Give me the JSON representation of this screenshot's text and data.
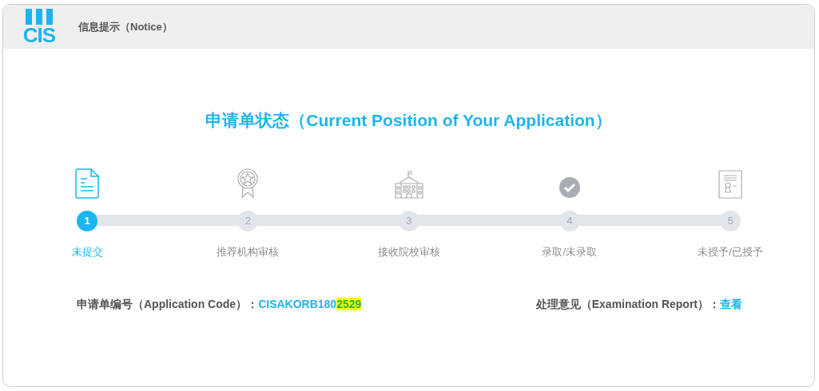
{
  "header": {
    "logo": "CIS",
    "title": "信息提示（Notice）"
  },
  "heading": "申请单状态（Current Position of Your Application）",
  "steps": [
    {
      "kind": "document",
      "number": "1",
      "label": "未提交",
      "selected": true
    },
    {
      "kind": "award",
      "number": "2",
      "label": "推荐机构审核",
      "selected": false
    },
    {
      "kind": "school",
      "number": "3",
      "label": "接收院校审核",
      "selected": false
    },
    {
      "kind": "check",
      "number": "4",
      "label": "录取/未录取",
      "selected": false
    },
    {
      "kind": "certificate",
      "number": "5",
      "label": "未授予/已授予",
      "selected": false
    }
  ],
  "application_code": {
    "label": "申请单编号（Application Code）：",
    "value": "CISAKORB180",
    "highlighted": "2529"
  },
  "examination_report": {
    "label": "处理意见（Examination Report）：",
    "link": "查看"
  }
}
